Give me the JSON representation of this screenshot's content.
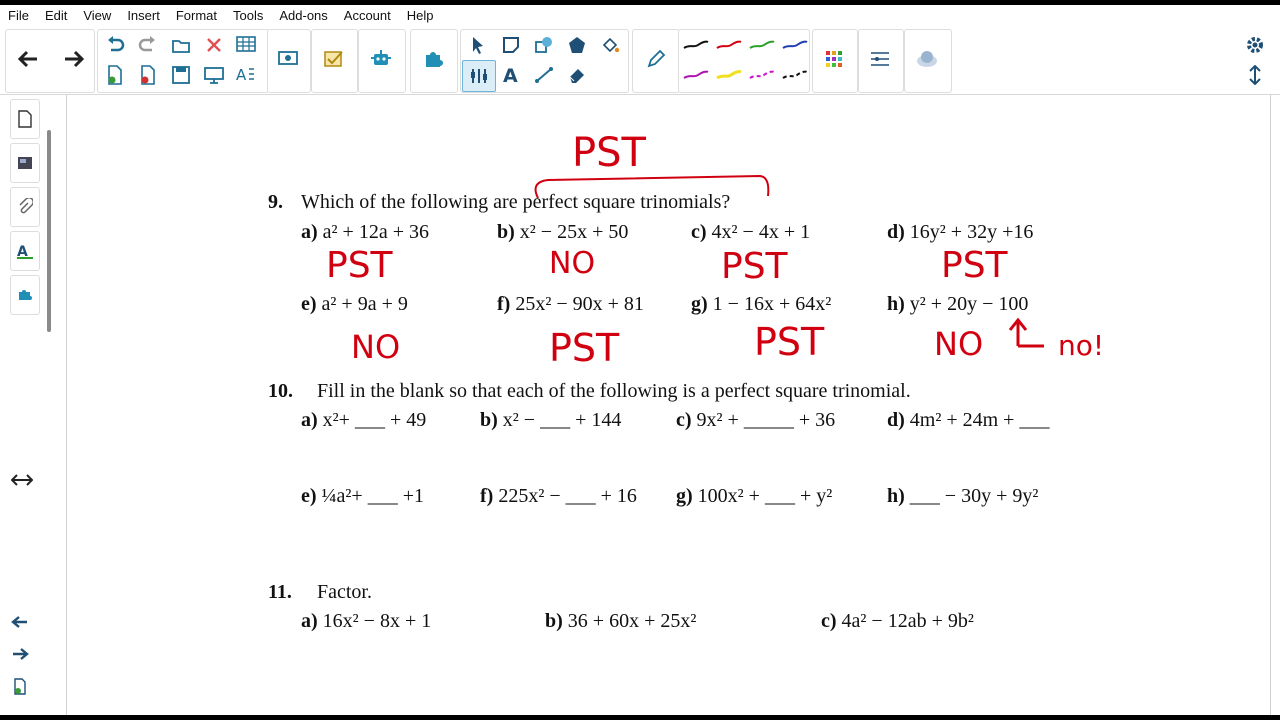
{
  "menu": [
    "File",
    "Edit",
    "View",
    "Insert",
    "Format",
    "Tools",
    "Add-ons",
    "Account",
    "Help"
  ],
  "colors": {
    "ink_red": "#d10010",
    "tool_blue": "#1f6f95"
  },
  "toolbar_icons": [
    "back-arrow-icon",
    "forward-arrow-icon",
    "undo-icon",
    "redo-icon",
    "open-folder-icon",
    "delete-icon",
    "table-icon",
    "new-page-icon",
    "remove-page-icon",
    "save-icon",
    "display-icon",
    "spellcheck-icon",
    "screen-capture-icon",
    "check-tool-icon",
    "robot-icon",
    "puzzle-icon",
    "select-icon",
    "sticky-note-icon",
    "shape-icon",
    "polygon-icon",
    "fill-icon",
    "cursor-tool-icon",
    "text-tool-icon",
    "line-tool-icon",
    "eraser-icon",
    "pen-icon",
    "palette-icon",
    "line-style-icon",
    "image-icon",
    "settings-icon",
    "expand-icon"
  ],
  "q9": {
    "number": "9.",
    "prompt": "Which of the following are perfect square trinomials?",
    "items": [
      {
        "label": "a)",
        "expr": "a² + 12a + 36"
      },
      {
        "label": "b)",
        "expr": "x² − 25x + 50"
      },
      {
        "label": "c)",
        "expr": "4x² − 4x + 1"
      },
      {
        "label": "d)",
        "expr": "16y² + 32y +16"
      },
      {
        "label": "e)",
        "expr": "a² + 9a + 9"
      },
      {
        "label": "f)",
        "expr": "25x² − 90x + 81"
      },
      {
        "label": "g)",
        "expr": "1 − 16x + 64x²"
      },
      {
        "label": "h)",
        "expr": "y² + 20y  − 100"
      }
    ]
  },
  "q10": {
    "number": "10.",
    "prompt": "Fill in the blank so that each of the following is a perfect square trinomial.",
    "items": [
      {
        "label": "a)",
        "expr": "x²+ ___ + 49"
      },
      {
        "label": "b)",
        "expr": "x² − ___ + 144"
      },
      {
        "label": "c)",
        "expr": "9x² + _____ + 36"
      },
      {
        "label": "d)",
        "expr": "4m² + 24m  + ___"
      },
      {
        "label": "e)",
        "expr": "¼a²+ ___ +1"
      },
      {
        "label": "f)",
        "expr": "225x² − ___ + 16"
      },
      {
        "label": "g)",
        "expr": "100x²  + ___ + y²"
      },
      {
        "label": "h)",
        "expr": "___ − 30y + 9y²"
      }
    ]
  },
  "q11": {
    "number": "11.",
    "prompt": "Factor.",
    "items": [
      {
        "label": "a)",
        "expr": "16x² − 8x + 1"
      },
      {
        "label": "b)",
        "expr": "36 + 60x + 25x²"
      },
      {
        "label": "c)",
        "expr": "4a² − 12ab + 9b²"
      }
    ]
  },
  "annotations": {
    "brace_label": "PST",
    "a": "PST",
    "b": "NO",
    "c": "PST",
    "d": "PST",
    "e": "NO",
    "f": "PST",
    "g": "PST",
    "h": "NO",
    "h_note": "no!"
  }
}
